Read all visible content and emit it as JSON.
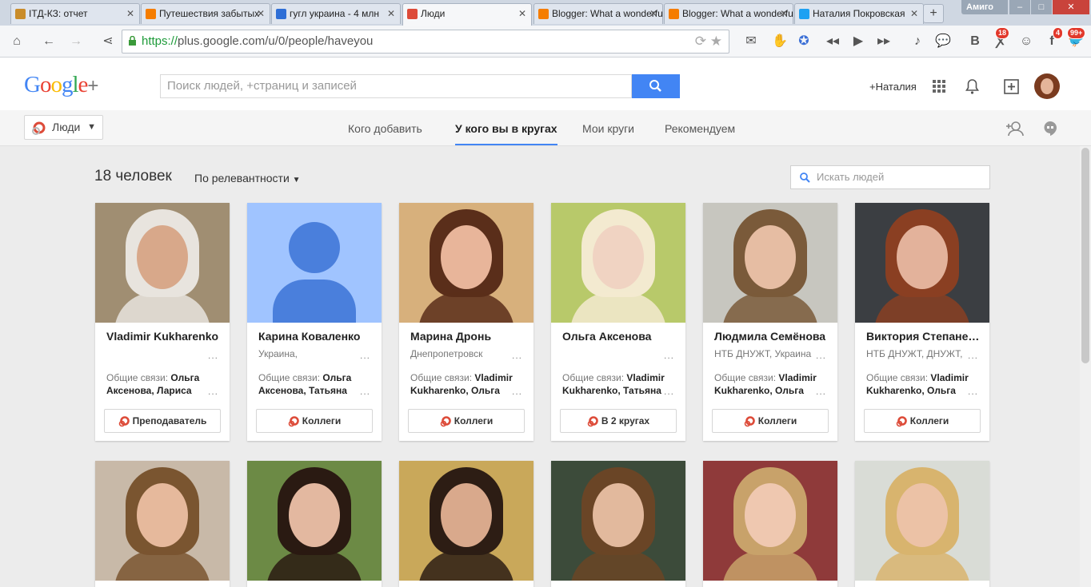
{
  "browser": {
    "tabs": [
      {
        "title": "ITД-КЗ: отчет",
        "icon": "library-icon",
        "color": "#c98c2a"
      },
      {
        "title": "Путешествия забытых",
        "icon": "blogger-icon",
        "color": "#f57d00"
      },
      {
        "title": "гугл украина - 4 млн",
        "icon": "search-favicon-icon",
        "color": "#2f6fd6"
      },
      {
        "title": "Люди",
        "icon": "google-plus-icon",
        "color": "#dd4b39",
        "active": true
      },
      {
        "title": "Blogger: What a wonderful",
        "icon": "blogger-icon",
        "color": "#f57d00"
      },
      {
        "title": "Blogger: What a wonderful",
        "icon": "blogger-icon",
        "color": "#f57d00"
      },
      {
        "title": "Наталия Покровская",
        "icon": "twitter-icon",
        "color": "#1da1f2"
      }
    ],
    "new_tab": "+",
    "brand": "Амиго",
    "url_scheme": "https://",
    "url_rest": "plus.google.com/u/0/people/haveyou",
    "badges": {
      "ok": "18",
      "fb": "4",
      "tw": "99+"
    }
  },
  "gplus": {
    "logo": "Google",
    "logo_plus": "+",
    "search_placeholder": "Поиск людей, +страниц и записей",
    "user_name": "+Наталия",
    "people_button": "Люди",
    "nav": [
      "Кого добавить",
      "У кого вы в кругах",
      "Мои круги",
      "Рекомендуем"
    ],
    "count": "18 человек",
    "sort": "По релевантности",
    "people_search_placeholder": "Искать людей"
  },
  "cards_row1": [
    {
      "name": "Vladimir Kukharenko",
      "location": "",
      "mutual_label": "Общие связи:",
      "mutual_names": "Ольга Аксенова, Лариса",
      "button": "Преподаватель",
      "photo_bg": "#a08e72",
      "skin": "#d8a88a",
      "hair": "#e8e4de"
    },
    {
      "name": "Карина Коваленко",
      "location": "Украина,",
      "mutual_label": "Общие связи:",
      "mutual_names": "Ольга Аксенова, Татьяна",
      "button": "Коллеги",
      "photo_bg": "#a0c4ff",
      "skin": "#4a7fdc",
      "hair": "#4a7fdc"
    },
    {
      "name": "Марина Дронь",
      "location": "Днепропетровск",
      "mutual_label": "Общие связи:",
      "mutual_names": "Vladimir Kukharenko, Ольга",
      "button": "Коллеги",
      "photo_bg": "#d7b07c",
      "skin": "#e8b59a",
      "hair": "#5a2e1a"
    },
    {
      "name": "Ольга Аксенова",
      "location": "",
      "mutual_label": "Общие связи:",
      "mutual_names": "Vladimir Kukharenko, Татьяна",
      "button": "В 2 кругах",
      "photo_bg": "#b8c96a",
      "skin": "#f0d3c2",
      "hair": "#f3ead0"
    },
    {
      "name": "Людмила Семёнова",
      "location": "НТБ ДНУЖТ, Украина",
      "mutual_label": "Общие связи:",
      "mutual_names": "Vladimir Kukharenko, Ольга",
      "button": "Коллеги",
      "photo_bg": "#c7c6bf",
      "skin": "#e6bda3",
      "hair": "#7a5a3a"
    },
    {
      "name": "Виктория Степаненко",
      "location": "НТБ ДНУЖТ, ДНУЖТ,",
      "mutual_label": "Общие связи:",
      "mutual_names": "Vladimir Kukharenko, Ольга",
      "button": "Коллеги",
      "photo_bg": "#3b3e42",
      "skin": "#e3b29b",
      "hair": "#8a3f22"
    }
  ],
  "cards_row2": [
    {
      "photo_bg": "#c8b9a8",
      "skin": "#e6b99c",
      "hair": "#7a5530"
    },
    {
      "photo_bg": "#6c8a45",
      "skin": "#e3b8a0",
      "hair": "#2a1a12"
    },
    {
      "photo_bg": "#c9a85a",
      "skin": "#d9a98c",
      "hair": "#2d1d14"
    },
    {
      "photo_bg": "#3c4b3a",
      "skin": "#e2b99d",
      "hair": "#6a4526"
    },
    {
      "photo_bg": "#8f3a3a",
      "skin": "#efc8b0",
      "hair": "#c8a26a"
    },
    {
      "photo_bg": "#d9dcd6",
      "skin": "#ecc2a6",
      "hair": "#d8b46e"
    }
  ]
}
